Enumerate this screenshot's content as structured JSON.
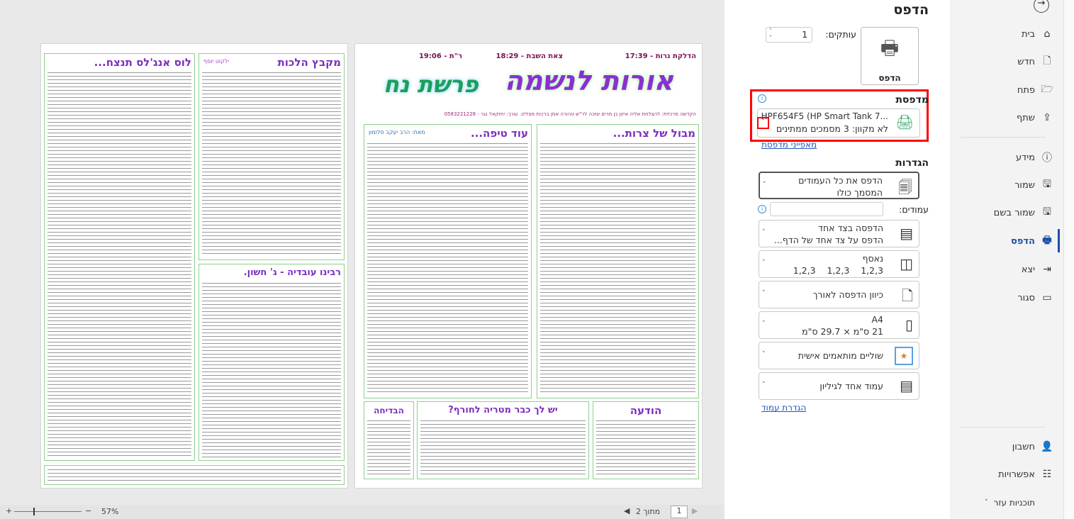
{
  "sidebar": {
    "back_icon": "arrow-back",
    "items": [
      {
        "label": "בית",
        "icon": "home"
      },
      {
        "label": "חדש",
        "icon": "new-doc"
      },
      {
        "label": "פתח",
        "icon": "folder-open"
      },
      {
        "label": "שתף",
        "icon": "share"
      },
      {
        "label": "מידע",
        "icon": "info"
      },
      {
        "label": "שמור",
        "icon": "save"
      },
      {
        "label": "שמור בשם",
        "icon": "save-as"
      },
      {
        "label": "הדפס",
        "icon": "print",
        "active": true
      },
      {
        "label": "יצא",
        "icon": "export"
      },
      {
        "label": "סגור",
        "icon": "folder"
      },
      {
        "label": "חשבון",
        "icon": "user"
      },
      {
        "label": "אפשרויות",
        "icon": "options"
      }
    ],
    "help": "תוכניות עזר"
  },
  "settings": {
    "title": "הדפס",
    "print_button": "הדפס",
    "copies_label": "עותקים:",
    "copies_value": "1",
    "printer_heading": "מדפסת",
    "printer_name": "HPF654F5 (HP Smart Tank 7...",
    "printer_status": "לא מקוון: 3 מסמכים ממתינים",
    "printer_properties": "מאפייני מדפסת",
    "settings_heading": "הגדרות",
    "print_all_line1": "הדפס את כל העמודים",
    "print_all_line2": "המסמך כולו",
    "pages_label": "עמודים:",
    "pages_value": "",
    "sided_line1": "הדפסה בצד אחד",
    "sided_line2": "הדפס על צד אחד של הדף...",
    "collate_line1": "נאסף",
    "collate_line2": "1,2,3    1,2,3    1,2,3",
    "orientation": "כיוון הדפסה לאורך",
    "paper_line1": "A4",
    "paper_line2": "21 ס\"מ × 29.7 ס\"מ",
    "margins": "שוליים מותאמים אישית",
    "per_sheet": "עמוד אחד לגיליון",
    "page_setup": "הגדרת עמוד"
  },
  "preview": {
    "page1": {
      "candle": "הדלקת נרות - 17:39",
      "shabbat_end": "צאת השבת - 18:29",
      "rt": "ר\"ת - 19:06",
      "title": "אורות לנשמה",
      "parasha": "פרשת נח",
      "dedication": "הקדשה מרכזית: להצלחת אליה איזון בן מרים שזכה לר\"ש טהורה אמן ברכות מצליט. עורך: יחזקאל נגר - 0583221228",
      "box_right": "מבול של צרות...",
      "box_left": "עוד טיפה...",
      "box_left_sub": "מאת: הרב יעקב סלומון",
      "notice": "הודעה",
      "umbrella": "יש לך כבר מטריה לחורף?",
      "joke": "הבדיחה"
    },
    "page2": {
      "halachot": "מקבץ הלכות",
      "halachot_sub": "ילקוט יוסף",
      "la": "לוס אנג'לס תנצח...",
      "ovadia": "רבינו עובדיה - ג' חשון."
    }
  },
  "bottom": {
    "zoom": "57%",
    "page_current": "1",
    "page_of": "מתוך 2"
  }
}
